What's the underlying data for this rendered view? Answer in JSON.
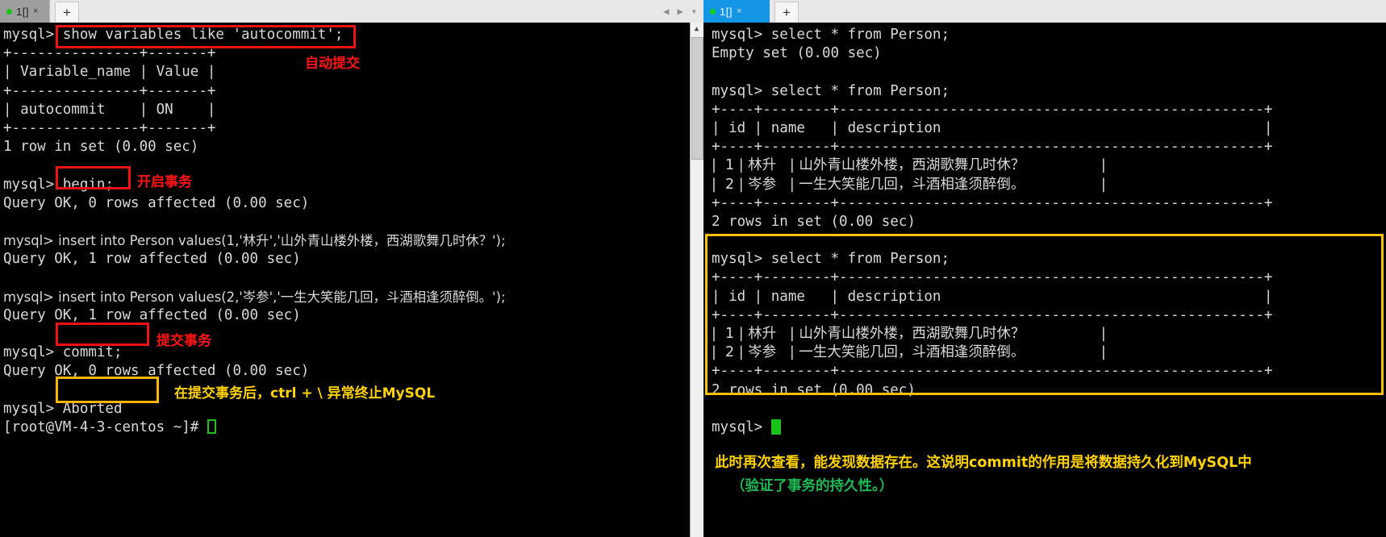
{
  "window": {
    "left_pane": {
      "tab": {
        "dot": "status-dot",
        "label": "1[]",
        "close": "×",
        "new_tab": "+",
        "active": false
      },
      "nav": {
        "back": "◀",
        "forward": "▶",
        "menu": "▾"
      }
    },
    "right_pane": {
      "tab": {
        "dot": "status-dot",
        "label": "1[]",
        "close": "×",
        "new_tab": "+",
        "active": true
      }
    }
  },
  "colors": {
    "terminal_bg": "#000000",
    "terminal_fg": "#d9d9d9",
    "annotation_red": "#ff1414",
    "annotation_yellow": "#ffd200",
    "annotation_green": "#1db954",
    "box_red": "#ee1111",
    "box_yellow": "#ffb400",
    "tab_active_bg": "#1595e6",
    "tab_inactive_bg": "#9e9e9e",
    "cursor_green": "#19c319"
  },
  "left_terminal": {
    "lines": [
      "mysql> show variables like 'autocommit';",
      "+---------------+-------+",
      "| Variable_name | Value |",
      "+---------------+-------+",
      "| autocommit    | ON    |",
      "+---------------+-------+",
      "1 row in set (0.00 sec)",
      "",
      "mysql> begin;",
      "Query OK, 0 rows affected (0.00 sec)",
      "",
      "mysql> insert into Person values(1,'林升','山外青山楼外楼，西湖歌舞几时休？');",
      "Query OK, 1 row affected (0.00 sec)",
      "",
      "mysql> insert into Person values(2,'岑参','一生大笑能几回，斗酒相逢须醉倒。');",
      "Query OK, 1 row affected (0.00 sec)",
      "",
      "mysql> commit;",
      "Query OK, 0 rows affected (0.00 sec)",
      "",
      "mysql> Aborted",
      "[root@VM-4-3-centos ~]# "
    ],
    "annotations": [
      {
        "text": "自动提交",
        "color": "red"
      },
      {
        "text": "开启事务",
        "color": "red"
      },
      {
        "text": "提交事务",
        "color": "red"
      },
      {
        "text": "在提交事务后，ctrl + \\ 异常终止MySQL",
        "color": "yellow"
      }
    ],
    "highlight_boxes": [
      {
        "target": "show variables like 'autocommit';",
        "color": "red"
      },
      {
        "target": "begin;",
        "color": "red"
      },
      {
        "target": "commit;",
        "color": "red"
      },
      {
        "target": "Aborted",
        "color": "yellow"
      }
    ]
  },
  "right_terminal": {
    "lines": [
      "mysql> select * from Person;",
      "Empty set (0.00 sec)",
      "",
      "mysql> select * from Person;",
      "+----+--------+--------------------------------------------------+",
      "| id | name   | description                                      |",
      "+----+--------+--------------------------------------------------+",
      "|  1 | 林升   | 山外青山楼外楼，西湖歌舞几时休？                 |",
      "|  2 | 岑参   | 一生大笑能几回，斗酒相逢须醉倒。                 |",
      "+----+--------+--------------------------------------------------+",
      "2 rows in set (0.00 sec)",
      "",
      "mysql> select * from Person;",
      "+----+--------+--------------------------------------------------+",
      "| id | name   | description                                      |",
      "+----+--------+--------------------------------------------------+",
      "|  1 | 林升   | 山外青山楼外楼，西湖歌舞几时休？                 |",
      "|  2 | 岑参   | 一生大笑能几回，斗酒相逢须醉倒。                 |",
      "+----+--------+--------------------------------------------------+",
      "2 rows in set (0.00 sec)",
      "",
      "mysql> "
    ],
    "annotations": [
      {
        "text": "此时再次查看，能发现数据存在。这说明commit的作用是将数据持久化到MySQL中",
        "color": "yellow"
      },
      {
        "text": "（验证了事务的持久性。）",
        "color": "green"
      }
    ],
    "highlight_boxes": [
      {
        "target": "second-select-block",
        "color": "yellow"
      }
    ]
  },
  "table_data": {
    "columns": [
      "id",
      "name",
      "description"
    ],
    "rows": [
      {
        "id": "1",
        "name": "林升",
        "description": "山外青山楼外楼，西湖歌舞几时休？"
      },
      {
        "id": "2",
        "name": "岑参",
        "description": "一生大笑能几回，斗酒相逢须醉倒。"
      }
    ],
    "footer": "2 rows in set (0.00 sec)"
  },
  "variables_table": {
    "columns": [
      "Variable_name",
      "Value"
    ],
    "rows": [
      {
        "Variable_name": "autocommit",
        "Value": "ON"
      }
    ],
    "footer": "1 row in set (0.00 sec)"
  },
  "scrollbar": {
    "up_arrow": "︿"
  }
}
